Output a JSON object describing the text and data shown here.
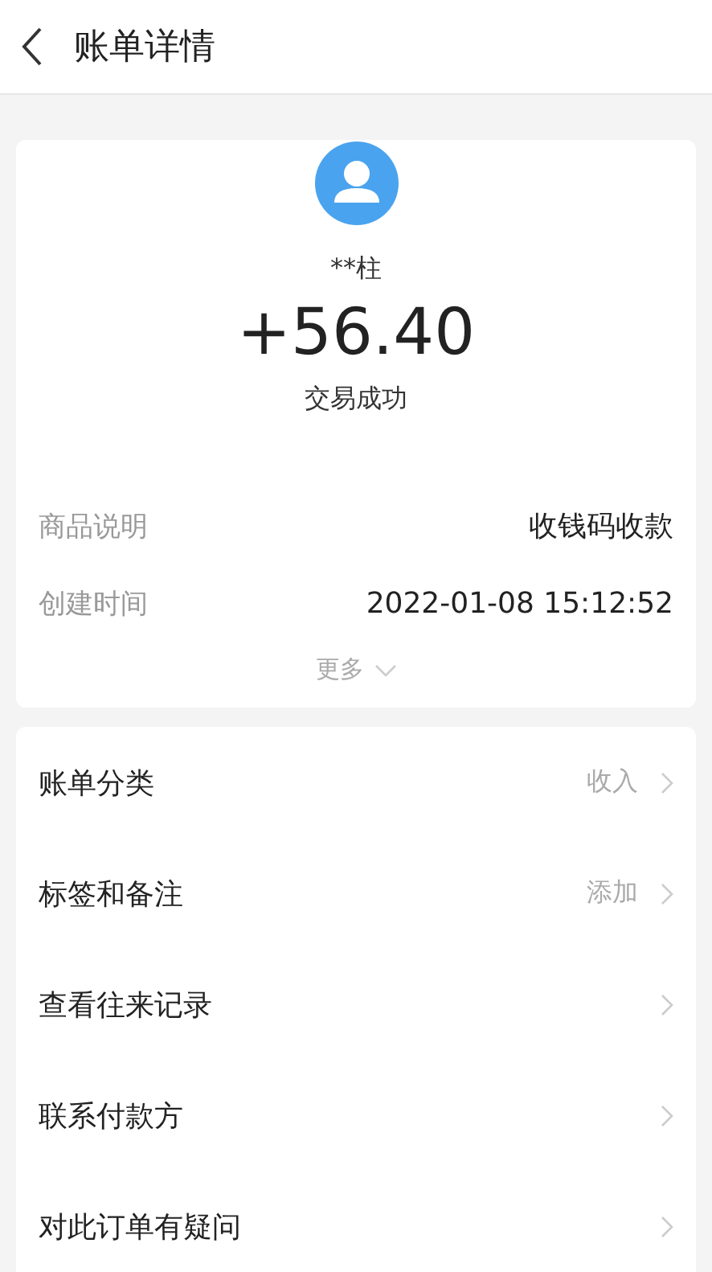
{
  "header": {
    "title": "账单详情"
  },
  "summary": {
    "payer": "**柱",
    "amount": "+56.40",
    "status": "交易成功"
  },
  "details": [
    {
      "label": "商品说明",
      "value": "收钱码收款"
    },
    {
      "label": "创建时间",
      "value": "2022-01-08 15:12:52"
    }
  ],
  "more": {
    "label": "更多"
  },
  "actions": [
    {
      "label": "账单分类",
      "value": "收入"
    },
    {
      "label": "标签和备注",
      "value": "添加"
    },
    {
      "label": "查看往来记录"
    },
    {
      "label": "联系付款方"
    },
    {
      "label": "对此订单有疑问"
    }
  ]
}
